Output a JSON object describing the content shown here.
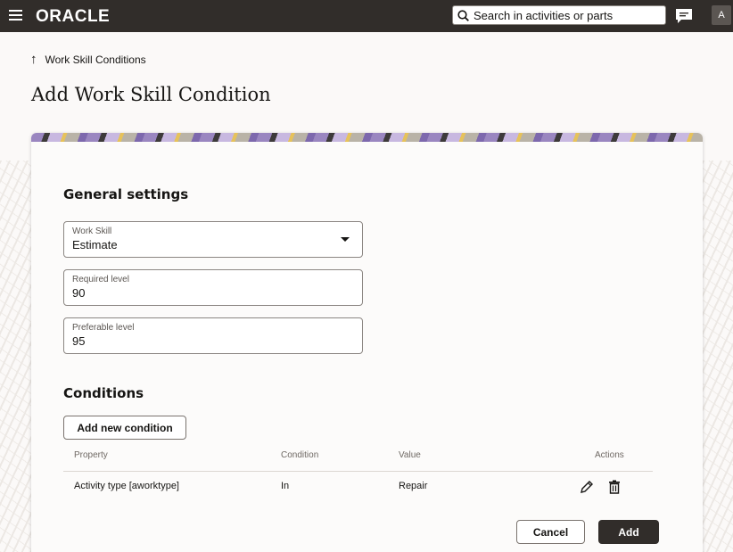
{
  "header": {
    "logo": "ORACLE",
    "search_placeholder": "Search in activities or parts",
    "avatar_initial": "A"
  },
  "breadcrumb": {
    "label": "Work Skill Conditions"
  },
  "page_title": "Add Work Skill Condition",
  "general": {
    "title": "General settings",
    "work_skill": {
      "label": "Work Skill",
      "value": "Estimate"
    },
    "required_level": {
      "label": "Required level",
      "value": "90"
    },
    "preferable_level": {
      "label": "Preferable level",
      "value": "95"
    }
  },
  "conditions": {
    "title": "Conditions",
    "add_button": "Add new condition",
    "columns": {
      "property": "Property",
      "condition": "Condition",
      "value": "Value",
      "actions": "Actions"
    },
    "rows": [
      {
        "property": "Activity type [aworktype]",
        "condition": "In",
        "value": "Repair"
      }
    ]
  },
  "footer": {
    "cancel": "Cancel",
    "add": "Add"
  },
  "colors": {
    "topbar": "#312d2a",
    "primary_button": "#312d2a",
    "background": "#fbf9f8"
  }
}
